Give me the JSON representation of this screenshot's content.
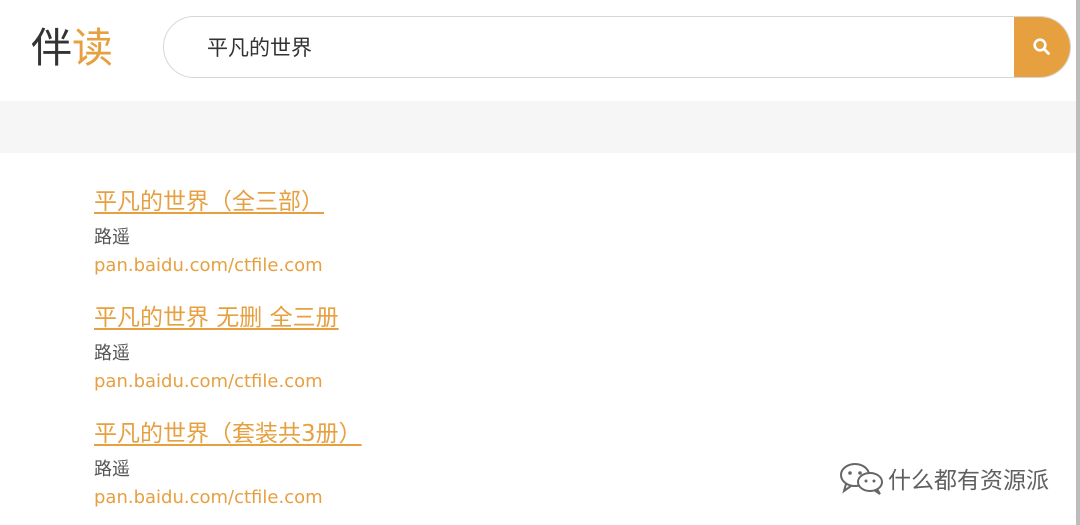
{
  "logo": {
    "part1": "伴",
    "part2": "读"
  },
  "search": {
    "value": "平凡的世界",
    "button_icon": "search-icon"
  },
  "results": [
    {
      "title": "平凡的世界（全三部）",
      "author": "路遥",
      "source": "pan.baidu.com/ctfile.com"
    },
    {
      "title": "平凡的世界 无删 全三册",
      "author": "路遥",
      "source": "pan.baidu.com/ctfile.com"
    },
    {
      "title": "平凡的世界（套装共3册）",
      "author": "路遥",
      "source": "pan.baidu.com/ctfile.com"
    }
  ],
  "watermark": {
    "text": "什么都有资源派",
    "icon": "wechat-icon"
  },
  "colors": {
    "accent": "#e6a040",
    "text": "#333333",
    "band": "#f6f6f6"
  }
}
